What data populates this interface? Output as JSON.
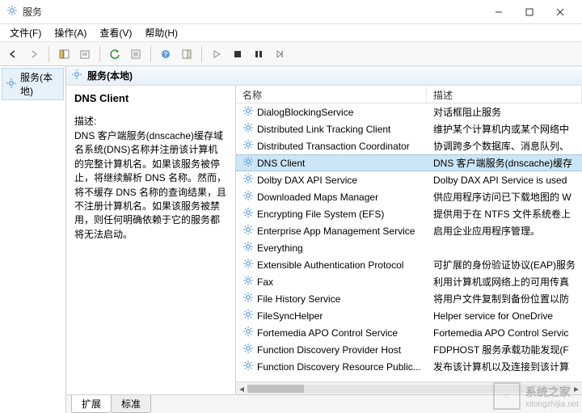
{
  "window": {
    "title": "服务"
  },
  "menu": {
    "file": "文件(F)",
    "action": "操作(A)",
    "view": "查看(V)",
    "help": "帮助(H)"
  },
  "nav": {
    "root": "服务(本地)"
  },
  "mainheader": {
    "title": "服务(本地)"
  },
  "detail": {
    "name": "DNS Client",
    "desc_label": "描述:",
    "desc": "DNS 客户端服务(dnscache)缓存域名系统(DNS)名称并注册该计算机的完整计算机名。如果该服务被停止，将继续解析 DNS 名称。然而，将不缓存 DNS 名称的查询结果，且不注册计算机名。如果该服务被禁用，则任何明确依赖于它的服务都将无法启动。"
  },
  "columns": {
    "name": "名称",
    "desc": "描述"
  },
  "services": [
    {
      "name": "DialogBlockingService",
      "desc": "对话框阻止服务"
    },
    {
      "name": "Distributed Link Tracking Client",
      "desc": "维护某个计算机内或某个网络中"
    },
    {
      "name": "Distributed Transaction Coordinator",
      "desc": "协调跨多个数据库、消息队列、"
    },
    {
      "name": "DNS Client",
      "desc": "DNS 客户端服务(dnscache)缓存"
    },
    {
      "name": "Dolby DAX API Service",
      "desc": "Dolby DAX API Service is used"
    },
    {
      "name": "Downloaded Maps Manager",
      "desc": "供应用程序访问已下载地图的 W"
    },
    {
      "name": "Encrypting File System (EFS)",
      "desc": "提供用于在 NTFS 文件系统卷上"
    },
    {
      "name": "Enterprise App Management Service",
      "desc": "启用企业应用程序管理。"
    },
    {
      "name": "Everything",
      "desc": ""
    },
    {
      "name": "Extensible Authentication Protocol",
      "desc": "可扩展的身份验证协议(EAP)服务"
    },
    {
      "name": "Fax",
      "desc": "利用计算机或网络上的可用传真"
    },
    {
      "name": "File History Service",
      "desc": "将用户文件复制到备份位置以防"
    },
    {
      "name": "FileSyncHelper",
      "desc": "Helper service for OneDrive"
    },
    {
      "name": "Fortemedia APO Control Service",
      "desc": "Fortemedia APO Control Servic"
    },
    {
      "name": "Function Discovery Provider Host",
      "desc": "FDPHOST 服务承载功能发现(F"
    },
    {
      "name": "Function Discovery Resource Public...",
      "desc": "发布该计算机以及连接到该计算"
    }
  ],
  "selected_index": 3,
  "tabs": {
    "ext": "扩展",
    "std": "标准"
  },
  "watermark": {
    "brand": "系统之家",
    "url": "xitongzhijia.net"
  }
}
